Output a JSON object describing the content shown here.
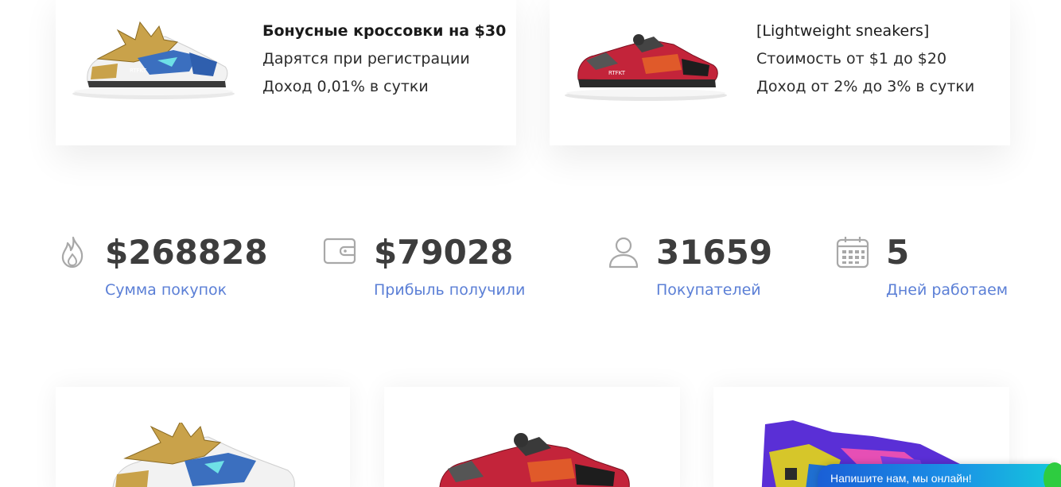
{
  "cards": [
    {
      "title": "Бонусные кроссовки на $30",
      "line1": "Дарятся при регистрации",
      "line2": "Доход 0,01% в сутки",
      "shoe_icon": "gold-white-blue-sneaker"
    },
    {
      "title": "[Lightweight sneakers]",
      "line1": "Стоимость от $1 до $20",
      "line2": "Доход от 2% до 3% в сутки",
      "shoe_icon": "red-black-sneaker"
    }
  ],
  "stats": [
    {
      "icon": "fire-icon",
      "value": "$268828",
      "label": "Сумма покупок"
    },
    {
      "icon": "wallet-icon",
      "value": "$79028",
      "label": "Прибыль получили"
    },
    {
      "icon": "user-icon",
      "value": "31659",
      "label": "Покупателей"
    },
    {
      "icon": "calendar-icon",
      "value": "5",
      "label": "Дней работаем"
    }
  ],
  "chat": {
    "label": "Напишите нам, мы онлайн!"
  },
  "colors": {
    "accent_link": "#5b7fd6",
    "stat_value": "#3d3d3d",
    "icon_gray": "#a8a8a8",
    "chat_start": "#1a5fd6",
    "chat_end": "#15c7dc"
  }
}
